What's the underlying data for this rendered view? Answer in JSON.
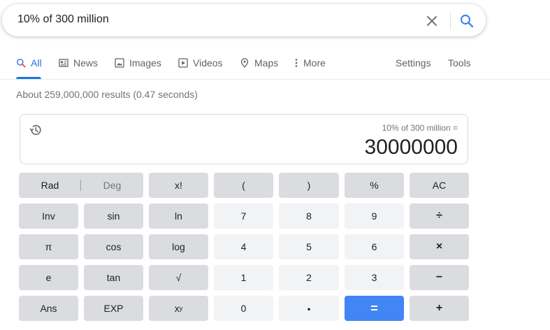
{
  "search": {
    "query": "10% of 300 million"
  },
  "tabs": [
    {
      "label": "All",
      "icon": "search-icon"
    },
    {
      "label": "News",
      "icon": "news-icon"
    },
    {
      "label": "Images",
      "icon": "image-icon"
    },
    {
      "label": "Videos",
      "icon": "video-icon"
    },
    {
      "label": "Maps",
      "icon": "map-pin-icon"
    },
    {
      "label": "More",
      "icon": "more-vert-icon"
    },
    {
      "label": "Settings"
    },
    {
      "label": "Tools"
    }
  ],
  "result_stats": "About 259,000,000 results (0.47 seconds)",
  "calculator": {
    "expression": "10% of 300 million =",
    "result": "30000000",
    "rad": "Rad",
    "deg": "Deg",
    "keys": {
      "fact": "x!",
      "lparen": "(",
      "rparen": ")",
      "percent": "%",
      "ac": "AC",
      "inv": "Inv",
      "sin": "sin",
      "ln": "ln",
      "k7": "7",
      "k8": "8",
      "k9": "9",
      "div": "÷",
      "pi": "π",
      "cos": "cos",
      "log": "log",
      "k4": "4",
      "k5": "5",
      "k6": "6",
      "mul": "×",
      "e": "e",
      "tan": "tan",
      "sqrt": "√",
      "k1": "1",
      "k2": "2",
      "k3": "3",
      "sub": "−",
      "ans": "Ans",
      "exp": "EXP",
      "pow_base": "x",
      "pow_sup": "y",
      "k0": "0",
      "dot": ".",
      "eq": "=",
      "add": "+"
    }
  },
  "colors": {
    "accent": "#1a73e8",
    "equals_key": "#4285f4",
    "key_dark": "#dadce0",
    "key_light": "#f1f3f4"
  }
}
